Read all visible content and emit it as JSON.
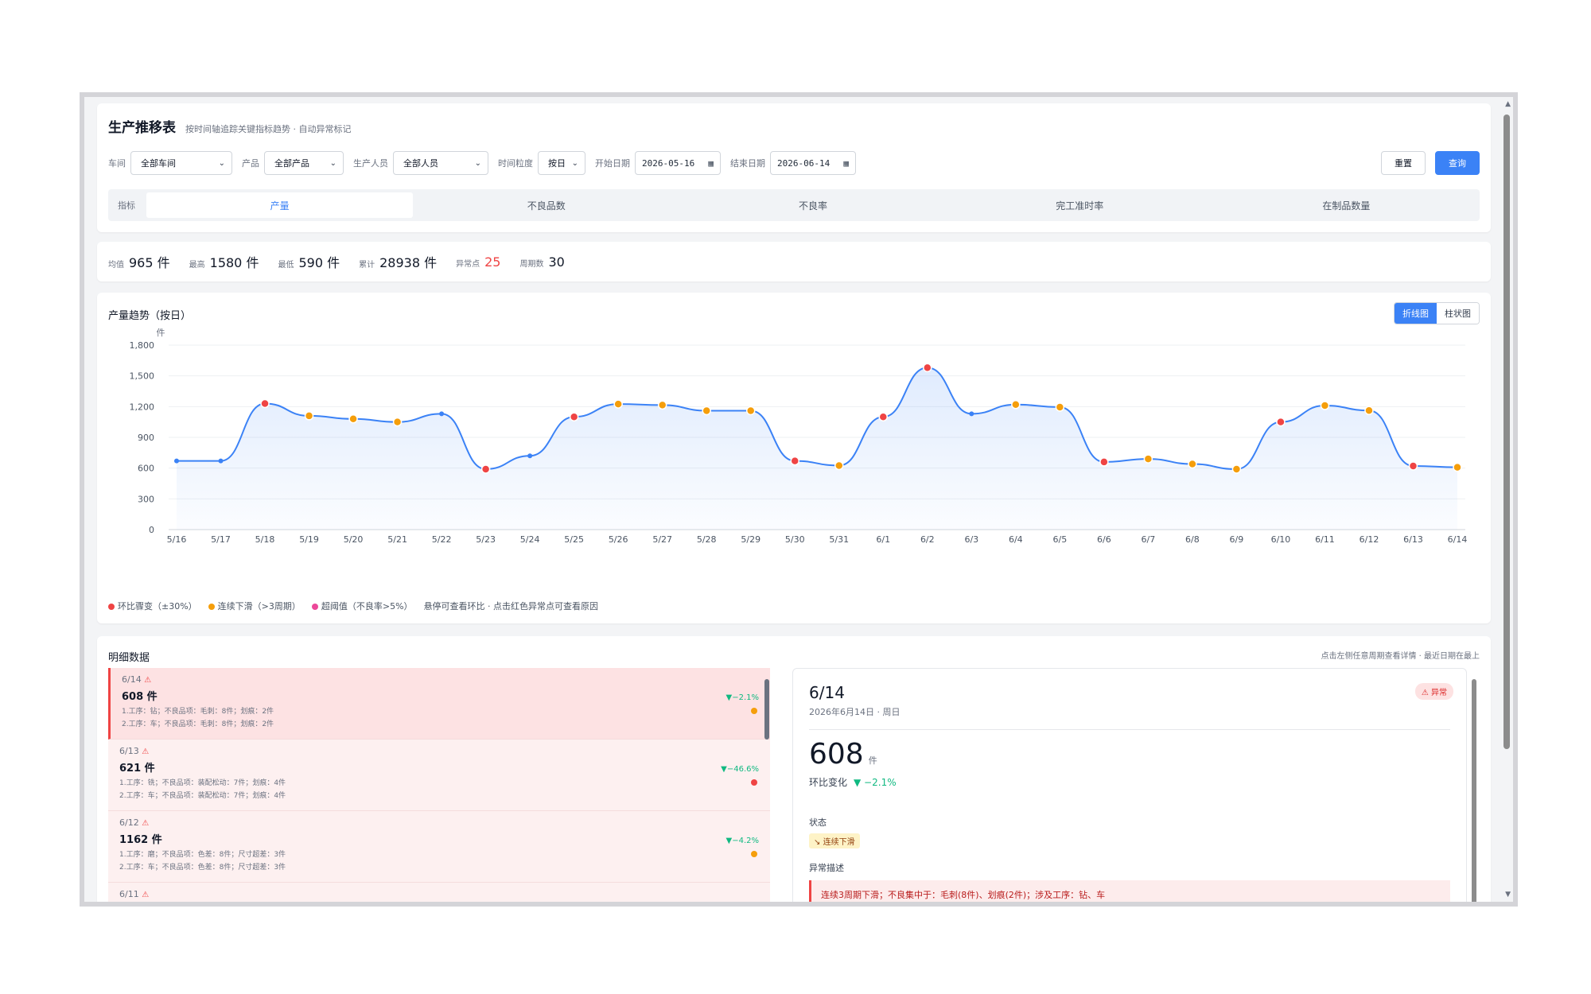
{
  "header": {
    "title": "生产推移表",
    "subtitle": "按时间轴追踪关键指标趋势 · 自动异常标记"
  },
  "filters": {
    "workshop_label": "车间",
    "workshop_value": "全部车间",
    "product_label": "产品",
    "product_value": "全部产品",
    "staff_label": "生产人员",
    "staff_value": "全部人员",
    "granularity_label": "时间粒度",
    "granularity_value": "按日",
    "start_label": "开始日期",
    "start_value": "2026-05-16",
    "end_label": "结束日期",
    "end_value": "2026-06-14",
    "reset_label": "重置",
    "query_label": "查询"
  },
  "metrics": {
    "label": "指标",
    "tabs": [
      "产量",
      "不良品数",
      "不良率",
      "完工准时率",
      "在制品数量"
    ],
    "active": 0
  },
  "stats": {
    "avg_label": "均值",
    "avg_value": "965 件",
    "max_label": "最高",
    "max_value": "1580 件",
    "min_label": "最低",
    "min_value": "590 件",
    "total_label": "累计",
    "total_value": "28938 件",
    "anomaly_label": "异常点",
    "anomaly_value": "25",
    "period_label": "周期数",
    "period_value": "30"
  },
  "chart": {
    "title": "产量趋势（按日）",
    "line_label": "折线图",
    "bar_label": "柱状图",
    "legend": [
      {
        "label": "环比骤变（±30%）",
        "color": "#ef4444"
      },
      {
        "label": "连续下滑（>3周期）",
        "color": "#f59e0b"
      },
      {
        "label": "超阈值（不良率>5%）",
        "color": "#ec4899"
      }
    ],
    "legend_hint": "悬停可查看环比 · 点击红色异常点可查看原因"
  },
  "chart_data": {
    "type": "area",
    "ylabel": "件",
    "ylim": [
      0,
      1800
    ],
    "yticks": [
      "0",
      "300",
      "600",
      "900",
      "1,200",
      "1,500",
      "1,800"
    ],
    "ytick_values": [
      0,
      300,
      600,
      900,
      1200,
      1500,
      1800
    ],
    "categories": [
      "5/16",
      "5/17",
      "5/18",
      "5/19",
      "5/20",
      "5/21",
      "5/22",
      "5/23",
      "5/24",
      "5/25",
      "5/26",
      "5/27",
      "5/28",
      "5/29",
      "5/30",
      "5/31",
      "6/1",
      "6/2",
      "6/3",
      "6/4",
      "6/5",
      "6/6",
      "6/7",
      "6/8",
      "6/9",
      "6/10",
      "6/11",
      "6/12",
      "6/13",
      "6/14"
    ],
    "values": [
      670,
      670,
      1230,
      1110,
      1080,
      1050,
      1130,
      590,
      720,
      1100,
      1225,
      1215,
      1160,
      1160,
      670,
      625,
      1100,
      1580,
      1130,
      1220,
      1195,
      660,
      690,
      640,
      590,
      1050,
      1210,
      1162,
      621,
      608
    ],
    "marker_types": [
      "n",
      "n",
      "r",
      "o",
      "o",
      "o",
      "n",
      "r",
      "n",
      "r",
      "o",
      "o",
      "o",
      "o",
      "r",
      "o",
      "r",
      "r",
      "n",
      "o",
      "o",
      "r",
      "o",
      "o",
      "o",
      "r",
      "o",
      "o",
      "r",
      "o"
    ],
    "colors": {
      "n": "#3b82f6",
      "r": "#ef4444",
      "o": "#f59e0b"
    },
    "line_color": "#3b82f6"
  },
  "details": {
    "title": "明细数据",
    "hint": "点击左侧任意周期查看详情 · 最近日期在最上",
    "items": [
      {
        "date": "6/14",
        "value": "608 件",
        "line1": "1.工序：钻；不良品项：毛刺：8件；划痕：2件",
        "line2": "2.工序：车；不良品项：毛刺：8件；划痕：2件",
        "change": "▼−2.1%",
        "dot": "#f59e0b"
      },
      {
        "date": "6/13",
        "value": "621 件",
        "line1": "1.工序：铣；不良品项：装配松动：7件；划痕：4件",
        "line2": "2.工序：车；不良品项：装配松动：7件；划痕：4件",
        "change": "▼−46.6%",
        "dot": "#ef4444"
      },
      {
        "date": "6/12",
        "value": "1162 件",
        "line1": "1.工序：磨；不良品项：色差：8件；尺寸超差：3件",
        "line2": "2.工序：车；不良品项：色差：8件；尺寸超差：3件",
        "change": "▼−4.2%",
        "dot": "#f59e0b"
      },
      {
        "date": "6/11",
        "value": "",
        "line1": "",
        "line2": "",
        "change": "",
        "dot": ""
      }
    ]
  },
  "panel": {
    "date": "6/14",
    "subtitle": "2026年6月14日 · 周日",
    "badge": "⚠ 异常",
    "value": "608",
    "unit": "件",
    "change_label": "环比变化",
    "change_value": "▼ −2.1%",
    "status_label": "状态",
    "status_tag": "连续下滑",
    "desc_label": "异常描述",
    "desc": "连续3周期下滑；不良集中于：毛刺(8件)、划痕(2件)；涉及工序：钻、车"
  }
}
